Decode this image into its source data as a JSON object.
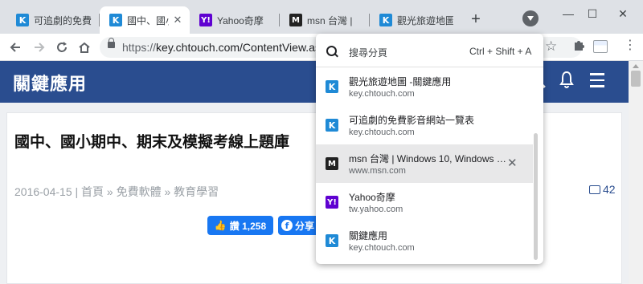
{
  "tabs": [
    {
      "title": "可追劇的免費",
      "favicon": "K"
    },
    {
      "title": "國中、國小期",
      "favicon": "K"
    },
    {
      "title": "Yahoo奇摩",
      "favicon": "Y!"
    },
    {
      "title": "msn 台灣 |",
      "favicon": "M"
    },
    {
      "title": "觀光旅遊地圖",
      "favicon": "K"
    }
  ],
  "tab_close": "✕",
  "new_tab": "+",
  "window": {
    "minimize": "—",
    "maximize": "☐",
    "close": "✕"
  },
  "omnibox": {
    "scheme": "https://",
    "url": "key.chtouch.com/ContentView.aspx"
  },
  "site": {
    "title": "關鍵應用",
    "article_title": "國中、國小期中、期末及模擬考線上題庫",
    "meta": "2016-04-15 | 首頁 » 免費軟體 » 教育學習",
    "comment_count": "42",
    "like_label": "讚 1,258",
    "share_label": "分享"
  },
  "tab_search": {
    "placeholder": "搜尋分頁",
    "shortcut": "Ctrl + Shift + A",
    "items": [
      {
        "title": "觀光旅遊地圖 -關鍵應用",
        "domain": "key.chtouch.com",
        "favicon": "K"
      },
      {
        "title": "可追劇的免費影音網站一覽表",
        "domain": "key.chtouch.com",
        "favicon": "K"
      },
      {
        "title": "msn 台灣 | Windows 10, Windows …",
        "domain": "www.msn.com",
        "favicon": "M",
        "close": "✕"
      },
      {
        "title": "Yahoo奇摩",
        "domain": "tw.yahoo.com",
        "favicon": "Y!"
      },
      {
        "title": "關鍵應用",
        "domain": "key.chtouch.com",
        "favicon": "K"
      }
    ]
  },
  "colors": {
    "tabstrip": "#dee1e6",
    "site_header": "#2a4d8f",
    "facebook": "#1877f2",
    "favicon_k": "#1f8ad6",
    "favicon_yahoo": "#5f01d1"
  }
}
